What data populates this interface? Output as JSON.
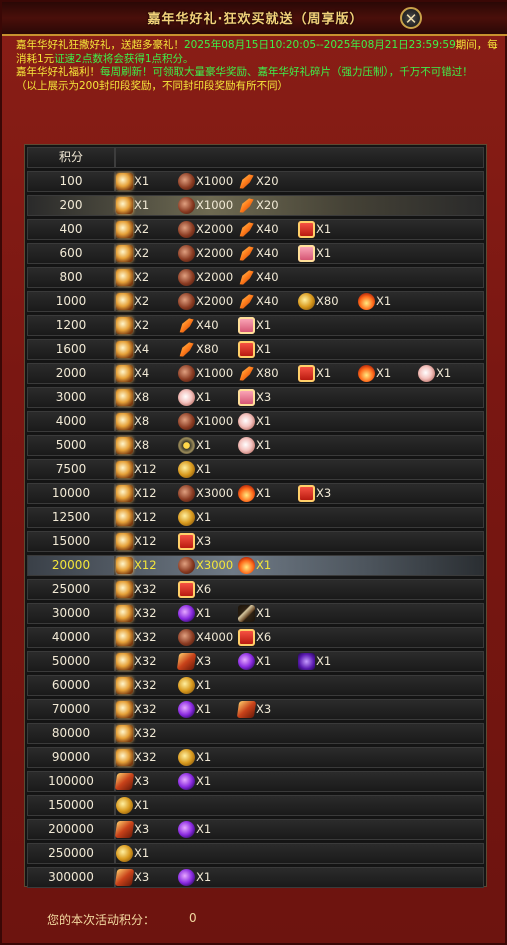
{
  "window": {
    "title": "嘉年华好礼·狂欢买就送（周享版）"
  },
  "notice": {
    "line1": "嘉年华好礼狂撒好礼，送超多豪礼！",
    "line1_time": "2025年08月15日10:20:05--2025年08月21日23:59:59",
    "line2": "期间，每消耗1元",
    "line2_b": "证速2点数将会获得1点积分。",
    "line3": "嘉年华好礼福利！",
    "line3_b": "每周刷新！可领取大量豪华奖励、嘉年华好礼碎片（强力压制），千万不可错过！",
    "line4": "（以上展示为200封印段奖励，不同封印段奖励有所不同）"
  },
  "table": {
    "header_score": "积分",
    "rows": [
      {
        "score": "100",
        "items": [
          {
            "icon": "scroll-icon",
            "qty": "X1"
          },
          {
            "icon": "ore-icon",
            "qty": "X1000"
          },
          {
            "icon": "feather-icon",
            "qty": "X20"
          }
        ]
      },
      {
        "score": "200",
        "items": [
          {
            "icon": "scroll-icon",
            "qty": "X1"
          },
          {
            "icon": "ore-icon",
            "qty": "X1000"
          },
          {
            "icon": "feather-icon",
            "qty": "X20"
          }
        ]
      },
      {
        "score": "400",
        "items": [
          {
            "icon": "scroll-icon",
            "qty": "X2"
          },
          {
            "icon": "ore-icon",
            "qty": "X2000"
          },
          {
            "icon": "feather-icon",
            "qty": "X40"
          },
          {
            "icon": "red-gift-icon",
            "qty": "X1"
          }
        ]
      },
      {
        "score": "600",
        "items": [
          {
            "icon": "scroll-icon",
            "qty": "X2"
          },
          {
            "icon": "ore-icon",
            "qty": "X2000"
          },
          {
            "icon": "feather-icon",
            "qty": "X40"
          },
          {
            "icon": "pink-gift-icon",
            "qty": "X1"
          }
        ]
      },
      {
        "score": "800",
        "items": [
          {
            "icon": "scroll-icon",
            "qty": "X2"
          },
          {
            "icon": "ore-icon",
            "qty": "X2000"
          },
          {
            "icon": "feather-icon",
            "qty": "X40"
          }
        ]
      },
      {
        "score": "1000",
        "items": [
          {
            "icon": "scroll-icon",
            "qty": "X2"
          },
          {
            "icon": "ore-icon",
            "qty": "X2000"
          },
          {
            "icon": "feather-icon",
            "qty": "X40"
          },
          {
            "icon": "coin-icon",
            "qty": "X80"
          },
          {
            "icon": "fire-icon",
            "qty": "X1"
          }
        ]
      },
      {
        "score": "1200",
        "items": [
          {
            "icon": "scroll-icon",
            "qty": "X2"
          },
          {
            "icon": "feather-icon",
            "qty": "X40"
          },
          {
            "icon": "pink-gift-icon",
            "qty": "X1"
          }
        ]
      },
      {
        "score": "1600",
        "items": [
          {
            "icon": "scroll-icon",
            "qty": "X4"
          },
          {
            "icon": "feather-icon",
            "qty": "X80"
          },
          {
            "icon": "red-gift-icon",
            "qty": "X1"
          }
        ]
      },
      {
        "score": "2000",
        "items": [
          {
            "icon": "scroll-icon",
            "qty": "X4"
          },
          {
            "icon": "ore-icon",
            "qty": "X1000"
          },
          {
            "icon": "feather-icon",
            "qty": "X80"
          },
          {
            "icon": "red-gift-icon",
            "qty": "X1"
          },
          {
            "icon": "fire-icon",
            "qty": "X1"
          },
          {
            "icon": "flower-icon",
            "qty": "X1"
          }
        ]
      },
      {
        "score": "3000",
        "items": [
          {
            "icon": "scroll-icon",
            "qty": "X8"
          },
          {
            "icon": "flower-icon",
            "qty": "X1"
          },
          {
            "icon": "pink-gift-icon",
            "qty": "X3"
          }
        ]
      },
      {
        "score": "4000",
        "items": [
          {
            "icon": "scroll-icon",
            "qty": "X8"
          },
          {
            "icon": "ore-icon",
            "qty": "X1000"
          },
          {
            "icon": "flower-icon",
            "qty": "X1"
          }
        ]
      },
      {
        "score": "5000",
        "items": [
          {
            "icon": "scroll-icon",
            "qty": "X8"
          },
          {
            "icon": "gear-icon",
            "qty": "X1"
          },
          {
            "icon": "flower-icon",
            "qty": "X1"
          }
        ]
      },
      {
        "score": "7500",
        "items": [
          {
            "icon": "scroll-icon",
            "qty": "X12"
          },
          {
            "icon": "coin-icon",
            "qty": "X1"
          }
        ]
      },
      {
        "score": "10000",
        "items": [
          {
            "icon": "scroll-icon",
            "qty": "X12"
          },
          {
            "icon": "ore-icon",
            "qty": "X3000"
          },
          {
            "icon": "fire-icon",
            "qty": "X1"
          },
          {
            "icon": "red-gift-icon",
            "qty": "X3"
          }
        ]
      },
      {
        "score": "12500",
        "items": [
          {
            "icon": "scroll-icon",
            "qty": "X12"
          },
          {
            "icon": "coin-icon",
            "qty": "X1"
          }
        ]
      },
      {
        "score": "15000",
        "items": [
          {
            "icon": "scroll-icon",
            "qty": "X12"
          },
          {
            "icon": "red-gift-icon",
            "qty": "X3"
          }
        ]
      },
      {
        "score": "20000",
        "items": [
          {
            "icon": "scroll-icon",
            "qty": "X12"
          },
          {
            "icon": "ore-icon",
            "qty": "X3000"
          },
          {
            "icon": "fire-icon",
            "qty": "X1"
          }
        ]
      },
      {
        "score": "25000",
        "items": [
          {
            "icon": "scroll-icon",
            "qty": "X32"
          },
          {
            "icon": "red-gift-icon",
            "qty": "X6"
          }
        ]
      },
      {
        "score": "30000",
        "items": [
          {
            "icon": "scroll-icon",
            "qty": "X32"
          },
          {
            "icon": "orb-icon",
            "qty": "X1"
          },
          {
            "icon": "sword-icon",
            "qty": "X1"
          }
        ]
      },
      {
        "score": "40000",
        "items": [
          {
            "icon": "scroll-icon",
            "qty": "X32"
          },
          {
            "icon": "ore-icon",
            "qty": "X4000"
          },
          {
            "icon": "red-gift-icon",
            "qty": "X6"
          }
        ]
      },
      {
        "score": "50000",
        "items": [
          {
            "icon": "scroll-icon",
            "qty": "X32"
          },
          {
            "icon": "token-icon",
            "qty": "X3"
          },
          {
            "icon": "orb-icon",
            "qty": "X1"
          },
          {
            "icon": "rune-icon",
            "qty": "X1"
          }
        ]
      },
      {
        "score": "60000",
        "items": [
          {
            "icon": "scroll-icon",
            "qty": "X32"
          },
          {
            "icon": "coin-icon",
            "qty": "X1"
          }
        ]
      },
      {
        "score": "70000",
        "items": [
          {
            "icon": "scroll-icon",
            "qty": "X32"
          },
          {
            "icon": "orb-icon",
            "qty": "X1"
          },
          {
            "icon": "token-icon",
            "qty": "X3"
          }
        ]
      },
      {
        "score": "80000",
        "items": [
          {
            "icon": "scroll-icon",
            "qty": "X32"
          }
        ]
      },
      {
        "score": "90000",
        "items": [
          {
            "icon": "scroll-icon",
            "qty": "X32"
          },
          {
            "icon": "coin-icon",
            "qty": "X1"
          }
        ]
      },
      {
        "score": "100000",
        "items": [
          {
            "icon": "token-icon",
            "qty": "X3"
          },
          {
            "icon": "orb-icon",
            "qty": "X1"
          }
        ]
      },
      {
        "score": "150000",
        "items": [
          {
            "icon": "coin-icon",
            "qty": "X1"
          }
        ]
      },
      {
        "score": "200000",
        "items": [
          {
            "icon": "token-icon",
            "qty": "X3"
          },
          {
            "icon": "orb-icon",
            "qty": "X1"
          }
        ]
      },
      {
        "score": "250000",
        "items": [
          {
            "icon": "coin-icon",
            "qty": "X1"
          }
        ]
      },
      {
        "score": "300000",
        "items": [
          {
            "icon": "token-icon",
            "qty": "X3"
          },
          {
            "icon": "orb-icon",
            "qty": "X1"
          }
        ]
      }
    ]
  },
  "footer": {
    "label": "您的本次活动积分：",
    "value": "0"
  }
}
